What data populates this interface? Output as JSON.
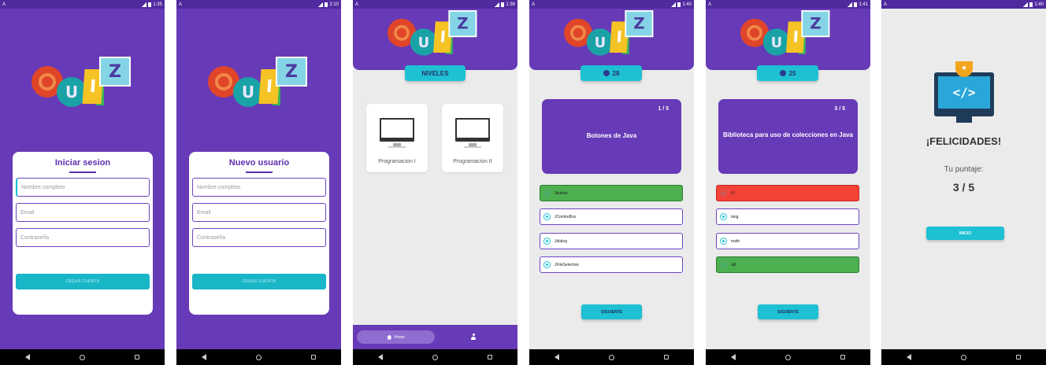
{
  "screens": [
    {
      "status": {
        "left": "A",
        "time": "1:35"
      },
      "form": {
        "title": "Iniciar sesion",
        "name_placeholder": "Nombre completo",
        "email_placeholder": "Email",
        "password_placeholder": "Contraseña",
        "button": "CREAR CUENTA"
      }
    },
    {
      "status": {
        "left": "A",
        "time": "2:10"
      },
      "form": {
        "title": "Nuevo usuario",
        "name_placeholder": "Nombre completo",
        "email_placeholder": "Email",
        "password_placeholder": "Contraseña",
        "button": "CREAR CUENTA"
      }
    },
    {
      "status": {
        "left": "A",
        "time": "1:36"
      },
      "levels_title": "NIVELES",
      "levels": [
        {
          "label": "Programacion I"
        },
        {
          "label": "Programacion II"
        }
      ],
      "bottom_nav": {
        "home": "Home"
      }
    },
    {
      "status": {
        "left": "A",
        "time": "1:40"
      },
      "timer": "28",
      "question": {
        "counter": "1 / 5",
        "text": "Botones de Java",
        "options": [
          "Jbutton",
          "JComboBox",
          "Jdialog",
          "JFileSelection"
        ]
      },
      "next": "SIGUIENTE"
    },
    {
      "status": {
        "left": "A",
        "time": "1:41"
      },
      "timer": "25",
      "question": {
        "counter": "3 / 5",
        "text": "Biblioteca para uso de colecciones en Java",
        "options": [
          "IO",
          "lang",
          "math",
          "util"
        ]
      },
      "next": "SIGUIENTE"
    },
    {
      "status": {
        "left": "A",
        "time": "1:40"
      },
      "result": {
        "title": "¡FELICIDADES!",
        "score_label": "Tu puntaje:",
        "score": "3 / 5",
        "button": "INICIO"
      }
    }
  ],
  "logo": {
    "letters": [
      "U",
      "I",
      "Z"
    ]
  },
  "colors": {
    "primary": "#673ab7",
    "accent": "#1ec0d3",
    "correct": "#4caf50",
    "wrong": "#f44336",
    "background": "#ebebeb"
  },
  "icons": [
    "back-icon",
    "home-icon",
    "recents-icon",
    "timer-icon",
    "person-icon",
    "monitor-icon",
    "trophy-icon"
  ]
}
